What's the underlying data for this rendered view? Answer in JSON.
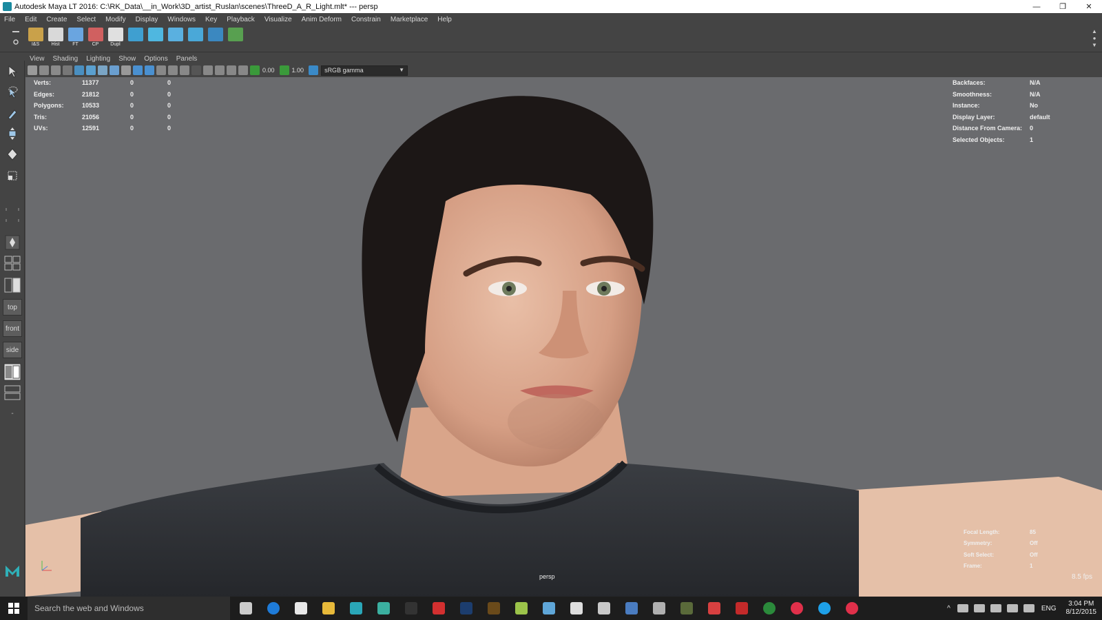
{
  "window": {
    "title": "Autodesk Maya LT 2016: C:\\RK_Data\\__in_Work\\3D_artist_Ruslan\\scenes\\ThreeD_A_R_Light.mlt*   ---   persp",
    "minimize": "—",
    "restore": "❐",
    "close": "✕"
  },
  "menus": [
    "File",
    "Edit",
    "Create",
    "Select",
    "Modify",
    "Display",
    "Windows",
    "Key",
    "Playback",
    "Visualize",
    "Anim Deform",
    "Constrain",
    "Marketplace",
    "Help"
  ],
  "shelf": {
    "tools": [
      {
        "label": "I&S",
        "color": "#c9a14a"
      },
      {
        "label": "Hist",
        "color": "#d9d9d9"
      },
      {
        "label": "FT",
        "color": "#6aa5e0"
      },
      {
        "label": "CP",
        "color": "#d06060"
      },
      {
        "label": "Dupl",
        "color": "#e0e0e0"
      },
      {
        "label": "",
        "color": "#3f9fd0"
      },
      {
        "label": "",
        "color": "#4fb7e0"
      },
      {
        "label": "",
        "color": "#5ab0e0"
      },
      {
        "label": "",
        "color": "#4aa8d8"
      },
      {
        "label": "",
        "color": "#3b88c0"
      },
      {
        "label": "",
        "color": "#58a050"
      }
    ]
  },
  "panel_menu": [
    "View",
    "Shading",
    "Lighting",
    "Show",
    "Options",
    "Panels"
  ],
  "panel_toolbar": {
    "exposure": "0.00",
    "gamma": "1.00",
    "color_space": "sRGB gamma"
  },
  "toolbox": {
    "views": [
      "top",
      "front",
      "side"
    ]
  },
  "hud_left": [
    {
      "label": "Verts:",
      "value": "11377",
      "c1": "0",
      "c2": "0"
    },
    {
      "label": "Edges:",
      "value": "21812",
      "c1": "0",
      "c2": "0"
    },
    {
      "label": "Polygons:",
      "value": "10533",
      "c1": "0",
      "c2": "0"
    },
    {
      "label": "Tris:",
      "value": "21056",
      "c1": "0",
      "c2": "0"
    },
    {
      "label": "UVs:",
      "value": "12591",
      "c1": "0",
      "c2": "0"
    }
  ],
  "hud_right": [
    {
      "label": "Backfaces:",
      "value": "N/A"
    },
    {
      "label": "Smoothness:",
      "value": "N/A"
    },
    {
      "label": "Instance:",
      "value": "No"
    },
    {
      "label": "Display Layer:",
      "value": "default"
    },
    {
      "label": "Distance From Camera:",
      "value": "0"
    },
    {
      "label": "Selected Objects:",
      "value": "1"
    }
  ],
  "hud_bottom_right": [
    {
      "label": "Focal Length:",
      "value": "85"
    },
    {
      "label": "Symmetry:",
      "value": "Off"
    },
    {
      "label": "Soft Select:",
      "value": "Off"
    },
    {
      "label": "Frame:",
      "value": "1"
    }
  ],
  "viewport": {
    "camera_label": "persp",
    "fps": "8.5 fps",
    "background": "#6a6b6e"
  },
  "taskbar": {
    "search_placeholder": "Search the web and Windows",
    "apps": [
      {
        "name": "task-view",
        "color": "#cccccc"
      },
      {
        "name": "edge",
        "color": "#1e7bd8"
      },
      {
        "name": "mail",
        "color": "#e8e8e8"
      },
      {
        "name": "explorer",
        "color": "#e7b93a"
      },
      {
        "name": "maya",
        "color": "#2aa7b8"
      },
      {
        "name": "maya-lt",
        "color": "#3bb0a0"
      },
      {
        "name": "epic",
        "color": "#333333"
      },
      {
        "name": "acrobat",
        "color": "#d33030"
      },
      {
        "name": "photoshop",
        "color": "#1c3d6e"
      },
      {
        "name": "bridge",
        "color": "#6a4a1a"
      },
      {
        "name": "notepad",
        "color": "#9cc44a"
      },
      {
        "name": "app-blue",
        "color": "#5fa6d8"
      },
      {
        "name": "calculator",
        "color": "#dddddd"
      },
      {
        "name": "app-globe",
        "color": "#c8c8c8"
      },
      {
        "name": "app-monitor",
        "color": "#4a7cc0"
      },
      {
        "name": "app-printer",
        "color": "#b0b0b0"
      },
      {
        "name": "app-dark",
        "color": "#5a6a3a"
      },
      {
        "name": "app-red",
        "color": "#d84040"
      },
      {
        "name": "filezilla",
        "color": "#c42a2a"
      },
      {
        "name": "app-green",
        "color": "#2b8a3b"
      },
      {
        "name": "itunes",
        "color": "#e0304a"
      },
      {
        "name": "skype",
        "color": "#1ea0e8"
      },
      {
        "name": "itunes-2",
        "color": "#e0304a"
      }
    ],
    "language": "ENG",
    "time": "3:04 PM",
    "date": "8/12/2015"
  }
}
